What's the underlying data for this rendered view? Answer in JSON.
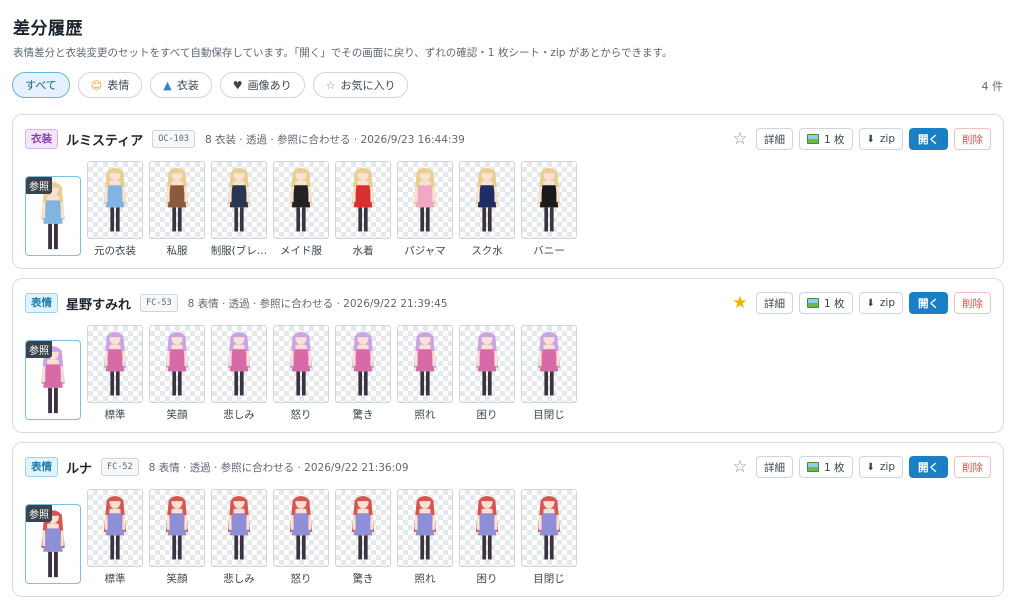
{
  "header": {
    "title": "差分履歴",
    "description": "表情差分と衣装変更のセットをすべて自動保存しています。「開く」でその画面に戻り、ずれの確認・1 枚シート・zip があとからできます。"
  },
  "filters": [
    {
      "label": "すべて",
      "icon": "",
      "active": true
    },
    {
      "label": "表情",
      "icon": "smiley-icon"
    },
    {
      "label": "衣装",
      "icon": "dress-icon"
    },
    {
      "label": "画像あり",
      "icon": "heart-icon"
    },
    {
      "label": "お気に入り",
      "icon": "star-outline-icon"
    }
  ],
  "count": "4 件",
  "actions": {
    "detail": "詳細",
    "sheet": "1 枚",
    "zip": "zip",
    "open": "開く",
    "delete": "削除"
  },
  "ref_label": "参照",
  "cards": [
    {
      "type": "衣装",
      "type_kind": "outfit",
      "name": "ルミスティア",
      "code": "OC-103",
      "meta": "8 衣装 · 透過 · 参照に合わせる · 2026/9/23 16:44:39",
      "favorite": false,
      "hair_color": "#e8cf8f",
      "thumbs": [
        {
          "label": "元の衣装",
          "outfit": "#7fb5e0"
        },
        {
          "label": "私服",
          "outfit": "#8b5a3c"
        },
        {
          "label": "制服(ブレ…",
          "outfit": "#2a3550"
        },
        {
          "label": "メイド服",
          "outfit": "#222222"
        },
        {
          "label": "水着",
          "outfit": "#d9302f"
        },
        {
          "label": "パジャマ",
          "outfit": "#f2a7c5"
        },
        {
          "label": "スク水",
          "outfit": "#1f2d66"
        },
        {
          "label": "バニー",
          "outfit": "#1a1a1a"
        }
      ]
    },
    {
      "type": "表情",
      "type_kind": "expr",
      "name": "星野すみれ",
      "code": "FC-53",
      "meta": "8 表情 · 透過 · 参照に合わせる · 2026/9/22 21:39:45",
      "favorite": true,
      "hair_color": "#c9a3e6",
      "thumbs": [
        {
          "label": "標準",
          "outfit": "#d86aa8"
        },
        {
          "label": "笑顔",
          "outfit": "#d86aa8"
        },
        {
          "label": "悲しみ",
          "outfit": "#d86aa8"
        },
        {
          "label": "怒り",
          "outfit": "#d86aa8"
        },
        {
          "label": "驚き",
          "outfit": "#d86aa8"
        },
        {
          "label": "照れ",
          "outfit": "#d86aa8"
        },
        {
          "label": "困り",
          "outfit": "#d86aa8"
        },
        {
          "label": "目閉じ",
          "outfit": "#d86aa8"
        }
      ]
    },
    {
      "type": "表情",
      "type_kind": "expr",
      "name": "ルナ",
      "code": "FC-52",
      "meta": "8 表情 · 透過 · 参照に合わせる · 2026/9/22 21:36:09",
      "favorite": false,
      "hair_color": "#d9534f",
      "thumbs": [
        {
          "label": "標準",
          "outfit": "#8f8fd8"
        },
        {
          "label": "笑顔",
          "outfit": "#8f8fd8"
        },
        {
          "label": "悲しみ",
          "outfit": "#8f8fd8"
        },
        {
          "label": "怒り",
          "outfit": "#8f8fd8"
        },
        {
          "label": "驚き",
          "outfit": "#8f8fd8"
        },
        {
          "label": "照れ",
          "outfit": "#8f8fd8"
        },
        {
          "label": "困り",
          "outfit": "#8f8fd8"
        },
        {
          "label": "目閉じ",
          "outfit": "#8f8fd8"
        }
      ]
    }
  ]
}
